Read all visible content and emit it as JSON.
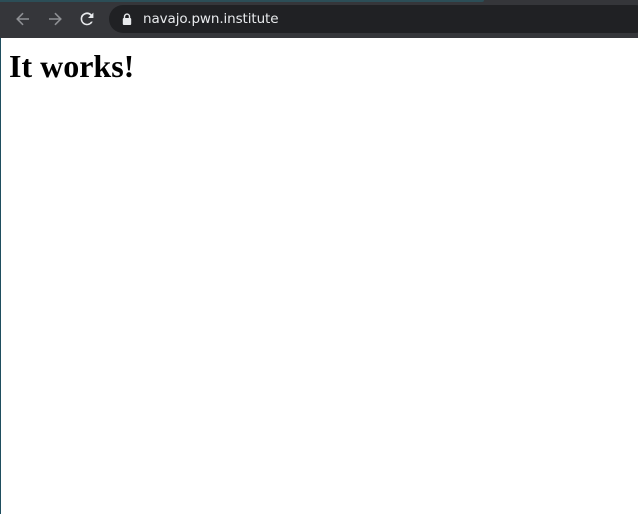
{
  "browser": {
    "url": "navajo.pwn.institute",
    "colors": {
      "toolbar": "#35363a",
      "omnibox": "#202124",
      "icon_dim": "#8e9094",
      "icon_bright": "#e8eaed"
    },
    "icons": {
      "back": "arrow-left-icon",
      "forward": "arrow-right-icon",
      "reload": "reload-icon",
      "secure": "lock-icon"
    }
  },
  "page": {
    "heading": "It works!"
  }
}
